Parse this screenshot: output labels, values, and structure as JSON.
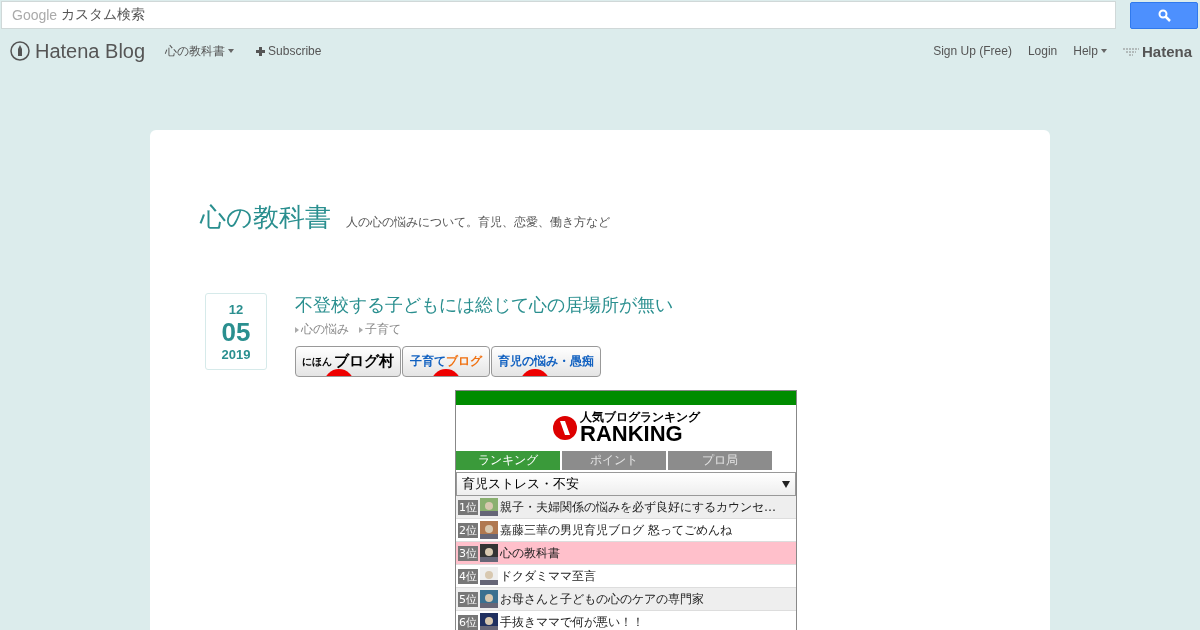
{
  "search": {
    "brand": "Google",
    "placeholder": "カスタム検索"
  },
  "navbar": {
    "logo": "Hatena Blog",
    "blog_menu": "心の教科書",
    "subscribe": "Subscribe",
    "links": [
      "Sign Up (Free)",
      "Login",
      "Help"
    ],
    "brand": "Hatena"
  },
  "blog": {
    "title": "心の教科書",
    "description": "人の心の悩みについて。育児、恋愛、働き方など"
  },
  "entry": {
    "date": {
      "month": "12",
      "day": "05",
      "year": "2019"
    },
    "title": "不登校する子どもには総じて心の居場所が無い",
    "categories": [
      "心の悩み",
      "子育て"
    ],
    "banners": [
      {
        "kind": "village",
        "small": "にほん",
        "label": "ブログ村"
      },
      {
        "kind": "parenting",
        "label": "子育て",
        "accent": "ブログ"
      },
      {
        "kind": "worry",
        "label": "育児の悩み・愚痴"
      }
    ]
  },
  "ranking": {
    "small": "人気ブログランキング",
    "logo": "RANKING",
    "tabs": [
      {
        "label": "ランキング",
        "selected": true
      },
      {
        "label": "ポイント",
        "selected": false
      },
      {
        "label": "プロ局",
        "selected": false
      }
    ],
    "category": "育児ストレス・不安",
    "rows": [
      {
        "rank": "1位",
        "title": "親子・夫婦関係の悩みを必ず良好にするカウンセ…",
        "selected": false
      },
      {
        "rank": "2位",
        "title": "嘉藤三華の男児育児ブログ 怒ってごめんね",
        "selected": false
      },
      {
        "rank": "3位",
        "title": "心の教科書",
        "selected": true
      },
      {
        "rank": "4位",
        "title": "ドクダミママ至言",
        "selected": false
      },
      {
        "rank": "5位",
        "title": "お母さんと子どもの心のケアの専門家",
        "selected": false
      },
      {
        "rank": "6位",
        "title": "手抜きママで何が悪い！！",
        "selected": false
      }
    ]
  }
}
